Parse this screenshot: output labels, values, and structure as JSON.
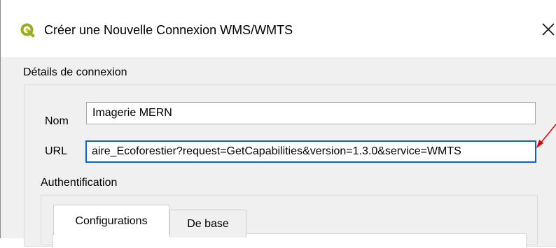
{
  "window": {
    "title": "Créer une Nouvelle Connexion WMS/WMTS",
    "app_icon": "qgis-logo-icon",
    "close_icon": "close-icon"
  },
  "connection_details": {
    "section_title": "Détails de connexion",
    "name": {
      "label": "Nom",
      "value": "Imagerie MERN"
    },
    "url": {
      "label": "URL",
      "value": "aire_Ecoforestier?request=GetCapabilities&version=1.3.0&service=WMTS"
    }
  },
  "authentication": {
    "title": "Authentification",
    "tabs": [
      {
        "label": "Configurations",
        "active": true
      },
      {
        "label": "De base",
        "active": false
      }
    ]
  },
  "colors": {
    "accent_focus": "#0a64c8",
    "annotation_arrow": "#e00000",
    "qgis_green": "#93b023",
    "qgis_yellow": "#f0c419"
  }
}
